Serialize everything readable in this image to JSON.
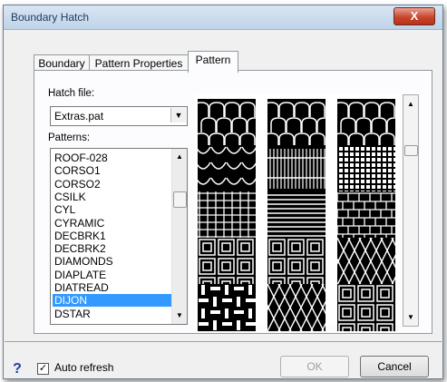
{
  "window": {
    "title": "Boundary Hatch",
    "close_glyph": "X"
  },
  "tabs": [
    {
      "label": "Boundary"
    },
    {
      "label": "Pattern Properties"
    },
    {
      "label": "Pattern"
    }
  ],
  "hatch_file": {
    "label": "Hatch file:",
    "value": "Extras.pat"
  },
  "patterns": {
    "label": "Patterns:",
    "items": [
      "ROOF-028",
      "CORSO1",
      "CORSO2",
      "CSILK",
      "CYL",
      "CYRAMIC",
      "DECBRK1",
      "DECBRK2",
      "DIAMONDS",
      "DIAPLATE",
      "DIATREAD",
      "DIJON",
      "DSTAR"
    ],
    "selected": "DIJON"
  },
  "previews": [
    "arches-a",
    "arches-b",
    "arches-c",
    "tiles-curved",
    "stripes-vertical",
    "grid-dots",
    "brick-grid",
    "horizontal-bands",
    "brick-offset",
    "square-links",
    "nested-squares",
    "diamond-lattice",
    "weave",
    "star-diamonds",
    "chain-squares"
  ],
  "footer": {
    "help_glyph": "?",
    "auto_refresh_label": "Auto refresh",
    "auto_refresh_checked": true,
    "check_glyph": "✓",
    "ok_label": "OK",
    "cancel_label": "Cancel"
  }
}
